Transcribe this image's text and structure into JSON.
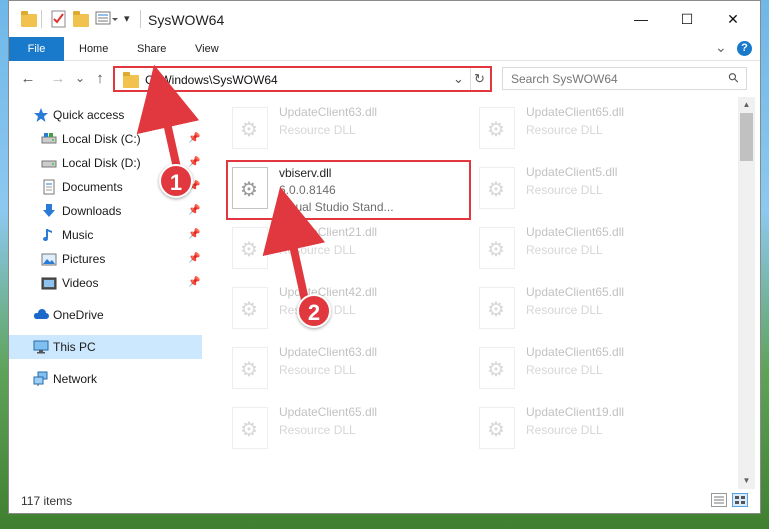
{
  "window": {
    "title": "SysWOW64",
    "minimize": "—",
    "maximize": "☐",
    "close": "✕"
  },
  "ribbon": {
    "tabs": [
      "File",
      "Home",
      "Share",
      "View"
    ],
    "help": "?",
    "expand": "⌄"
  },
  "nav": {
    "back": "←",
    "forward": "→",
    "recent": "⌄",
    "up": "↑",
    "address": "C:\\Windows\\SysWOW64",
    "address_dropdown": "⌄",
    "refresh": "↻",
    "search_placeholder": "Search SysWOW64",
    "search_icon": "⚲"
  },
  "sidebar": {
    "items": [
      {
        "label": "Quick access",
        "icon": "star-icon",
        "pinned": false
      },
      {
        "label": "Local Disk (C:)",
        "icon": "drive-icon",
        "pinned": true
      },
      {
        "label": "Local Disk (D:)",
        "icon": "drive-icon",
        "pinned": true
      },
      {
        "label": "Documents",
        "icon": "documents-icon",
        "pinned": true
      },
      {
        "label": "Downloads",
        "icon": "download-icon",
        "pinned": true
      },
      {
        "label": "Music",
        "icon": "music-icon",
        "pinned": true
      },
      {
        "label": "Pictures",
        "icon": "pictures-icon",
        "pinned": true
      },
      {
        "label": "Videos",
        "icon": "videos-icon",
        "pinned": true
      },
      {
        "label": "OneDrive",
        "icon": "cloud-icon",
        "pinned": false
      },
      {
        "label": "This PC",
        "icon": "computer-icon",
        "pinned": false,
        "selected": true
      },
      {
        "label": "Network",
        "icon": "network-icon",
        "pinned": false
      }
    ],
    "pin_glyph": "📌"
  },
  "files": {
    "left": [
      {
        "name": "UpdateClient63.dll",
        "type": "Resource DLL"
      },
      {
        "name": "vbiserv.dll",
        "version": "6.0.0.8146",
        "desc": "Visual Studio Stand...",
        "highlighted": true
      },
      {
        "name": "UpdateClient21.dll",
        "type": "Resource DLL"
      },
      {
        "name": "UpdateClient42.dll",
        "type": "Resource DLL"
      },
      {
        "name": "UpdateClient63.dll",
        "type": "Resource DLL"
      },
      {
        "name": "UpdateClient65.dll",
        "type": "Resource DLL"
      }
    ],
    "right": [
      {
        "name": "UpdateClient65.dll",
        "type": "Resource DLL"
      },
      {
        "name": "UpdateClient5.dll",
        "type": "Resource DLL"
      },
      {
        "name": "UpdateClient65.dll",
        "type": "Resource DLL"
      },
      {
        "name": "UpdateClient65.dll",
        "type": "Resource DLL"
      },
      {
        "name": "UpdateClient65.dll",
        "type": "Resource DLL"
      },
      {
        "name": "UpdateClient19.dll",
        "type": "Resource DLL"
      }
    ]
  },
  "status": {
    "items_count": "117 items"
  },
  "annotations": {
    "step1": "1",
    "step2": "2",
    "color": "#e0383e"
  }
}
